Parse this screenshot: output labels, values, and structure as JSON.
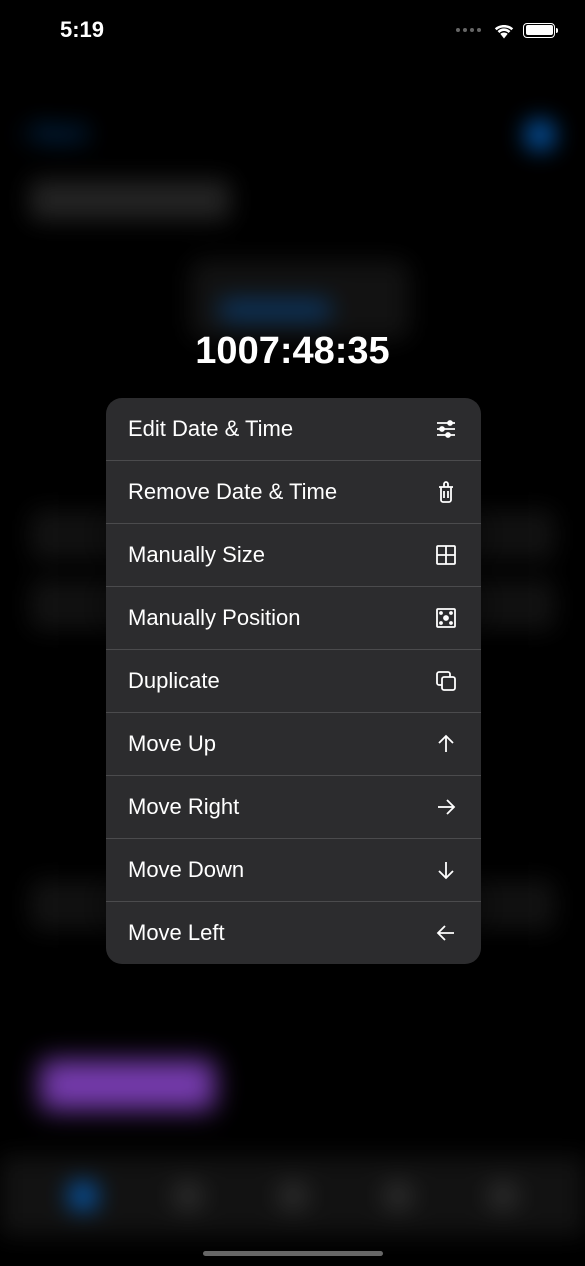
{
  "status_bar": {
    "time": "5:19"
  },
  "timer": {
    "value": "1007:48:35"
  },
  "menu": {
    "items": [
      {
        "label": "Edit Date & Time",
        "icon": "sliders-icon"
      },
      {
        "label": "Remove Date & Time",
        "icon": "trash-icon"
      },
      {
        "label": "Manually Size",
        "icon": "resize-icon"
      },
      {
        "label": "Manually Position",
        "icon": "position-icon"
      },
      {
        "label": "Duplicate",
        "icon": "duplicate-icon"
      },
      {
        "label": "Move Up",
        "icon": "arrow-up-icon"
      },
      {
        "label": "Move Right",
        "icon": "arrow-right-icon"
      },
      {
        "label": "Move Down",
        "icon": "arrow-down-icon"
      },
      {
        "label": "Move Left",
        "icon": "arrow-left-icon"
      }
    ]
  }
}
